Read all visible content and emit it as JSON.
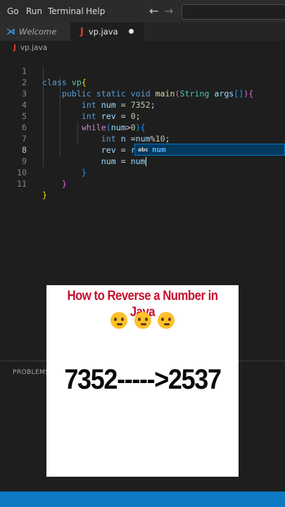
{
  "menu": {
    "items": [
      "Go",
      "Run",
      "Terminal",
      "Help"
    ]
  },
  "nav": {
    "back_icon": "arrow-left-icon",
    "forward_icon": "arrow-right-icon"
  },
  "tabs": [
    {
      "label": "Welcome",
      "icon": "vscode-icon"
    },
    {
      "label": "vp.java",
      "icon": "java-icon",
      "modified": true
    }
  ],
  "breadcrumb": {
    "file": "vp.java"
  },
  "editor": {
    "line_numbers": [
      "1",
      "2",
      "3",
      "4",
      "5",
      "6",
      "7",
      "8",
      "9",
      "10",
      "11"
    ],
    "current_line": 8,
    "lines": [
      "class vp{",
      "    public static void main(String args[]){",
      "        int num = 7352;",
      "        int rev = 0;",
      "        while(num>0){",
      "            int n =num%10;",
      "            rev = rev*10+n;",
      "            num = num",
      "        }",
      "    }",
      "}"
    ]
  },
  "suggestion": {
    "kind": "abc",
    "text": "num"
  },
  "panel": {
    "tab": "PROBLEMS"
  },
  "overlay": {
    "title": "How to Reverse a Number in Java",
    "emoji_icons": [
      "thinking-face-icon",
      "thinking-face-icon",
      "thinking-face-icon"
    ],
    "headline": "7352----->2537"
  },
  "colors": {
    "accent": "#007acc",
    "statusbar": "#0e7ac4",
    "title_red": "#c8102e"
  }
}
